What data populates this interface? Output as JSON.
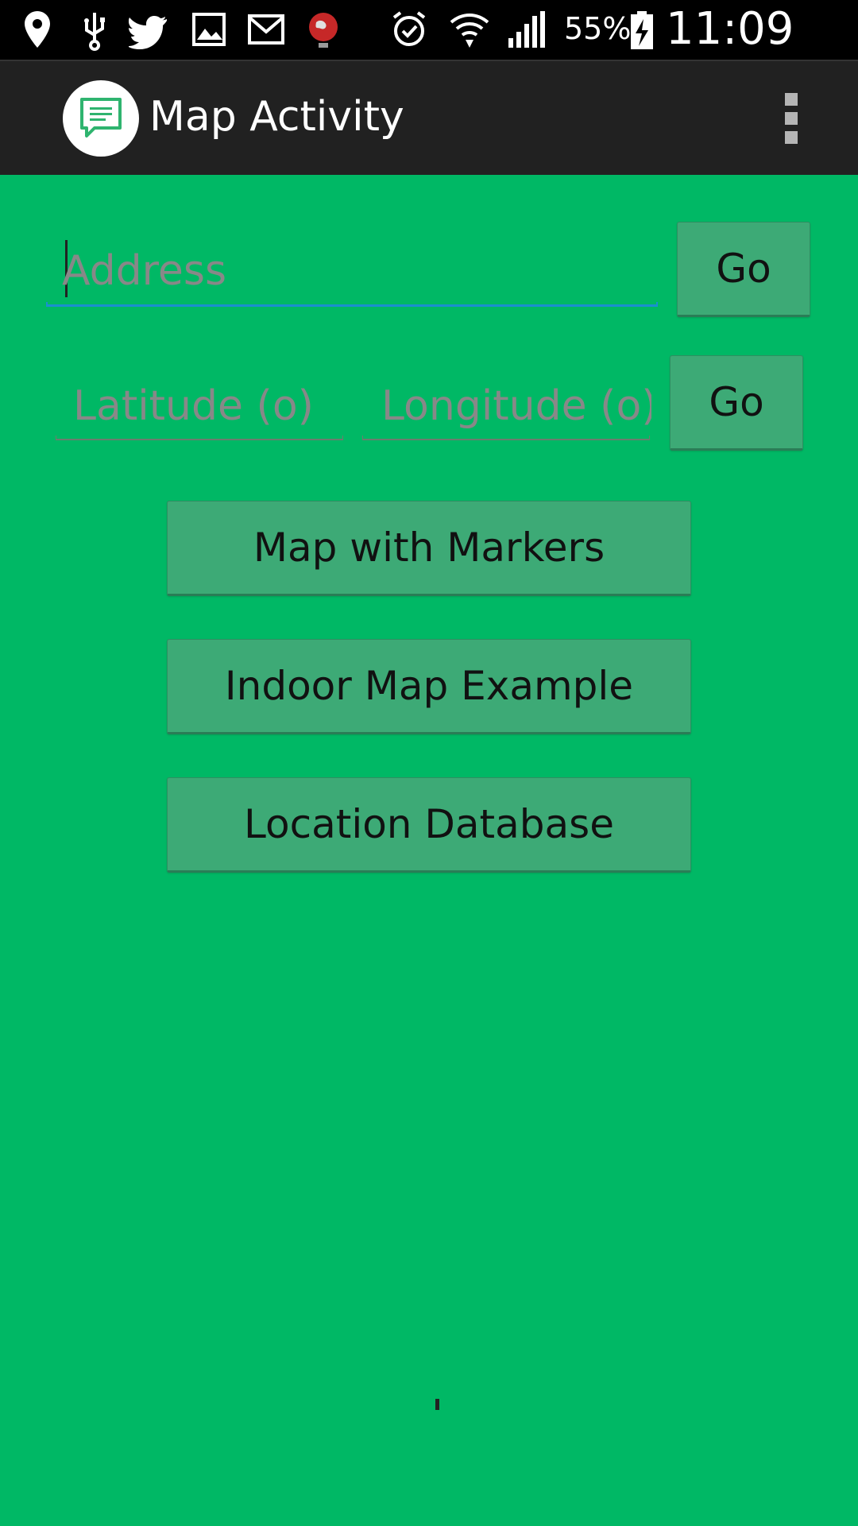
{
  "status_bar": {
    "icons": [
      "location-pin-icon",
      "usb-icon",
      "twitter-icon",
      "gallery-icon",
      "gmail-icon",
      "globe-icon",
      "alarm-icon",
      "wifi-icon",
      "signal-icon",
      "battery-charging-icon"
    ],
    "battery_percent": "55%",
    "time": "11:09 PM"
  },
  "action_bar": {
    "title": "Map Activity",
    "app_icon": "chat-bubble-icon",
    "menu_icon": "overflow-menu-icon"
  },
  "form": {
    "address": {
      "value": "",
      "placeholder": "Address"
    },
    "address_go_label": "Go",
    "latitude": {
      "value": "",
      "placeholder": "Latitude (o)"
    },
    "longitude": {
      "value": "",
      "placeholder": "Longitude (o)"
    },
    "latlng_go_label": "Go"
  },
  "buttons": {
    "markers": "Map with Markers",
    "indoor": "Indoor Map Example",
    "database": "Location Database"
  },
  "colors": {
    "background": "#00b865",
    "button": "#3daa76",
    "action_bar": "#212121",
    "focus_accent": "#1a8fd0"
  }
}
